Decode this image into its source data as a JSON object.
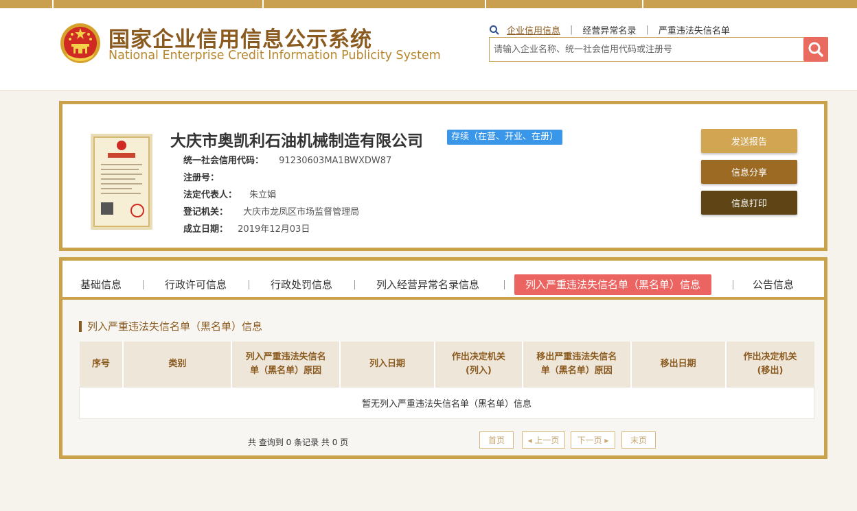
{
  "header": {
    "title_cn": "国家企业信用信息公示系统",
    "title_en": "National Enterprise Credit Information Publicity System",
    "emblem_icon": "national-emblem-icon",
    "nav_links": [
      "企业信用信息",
      "经营异常名录",
      "严重违法失信名单"
    ],
    "search_placeholder": "请输入企业名称、统一社会信用代码或注册号",
    "search_icon": "search-icon",
    "accent_color": "#c9a24a"
  },
  "company": {
    "name": "大庆市奥凯利石油机械制造有限公司",
    "status": "存续（在营、开业、在册）",
    "license_image": "business-license-icon",
    "fields": [
      {
        "label": "统一社会信用代码：",
        "value": "91230603MA1BWXDW87"
      },
      {
        "label": "注册号：",
        "value": ""
      },
      {
        "label": "法定代表人：",
        "value": "朱立娟"
      },
      {
        "label": "登记机关：",
        "value": "大庆市龙凤区市场监督管理局"
      },
      {
        "label": "成立日期：",
        "value": "2019年12月03日"
      }
    ],
    "actions": [
      "发送报告",
      "信息分享",
      "信息打印"
    ]
  },
  "tabs": [
    "基础信息",
    "行政许可信息",
    "行政处罚信息",
    "列入经营异常名录信息",
    "列入严重违法失信名单（黑名单）信息",
    "公告信息"
  ],
  "section": {
    "title": "列入严重违法失信名单（黑名单）信息",
    "columns": [
      [
        "序号"
      ],
      [
        "类别"
      ],
      [
        "列入严重违法失信名",
        "单（黑名单）原因"
      ],
      [
        "列入日期"
      ],
      [
        "作出决定机关",
        "(列入)"
      ],
      [
        "移出严重违法失信名",
        "单（黑名单）原因"
      ],
      [
        "移出日期"
      ],
      [
        "作出决定机关",
        "(移出)"
      ]
    ],
    "empty_text": "暂无列入严重违法失信名单（黑名单）信息",
    "summary": "共 查询到 0 条记录 共 0 页",
    "pagination": [
      "首页",
      "◂ 上一页",
      "下一页 ▸",
      "末页"
    ]
  }
}
